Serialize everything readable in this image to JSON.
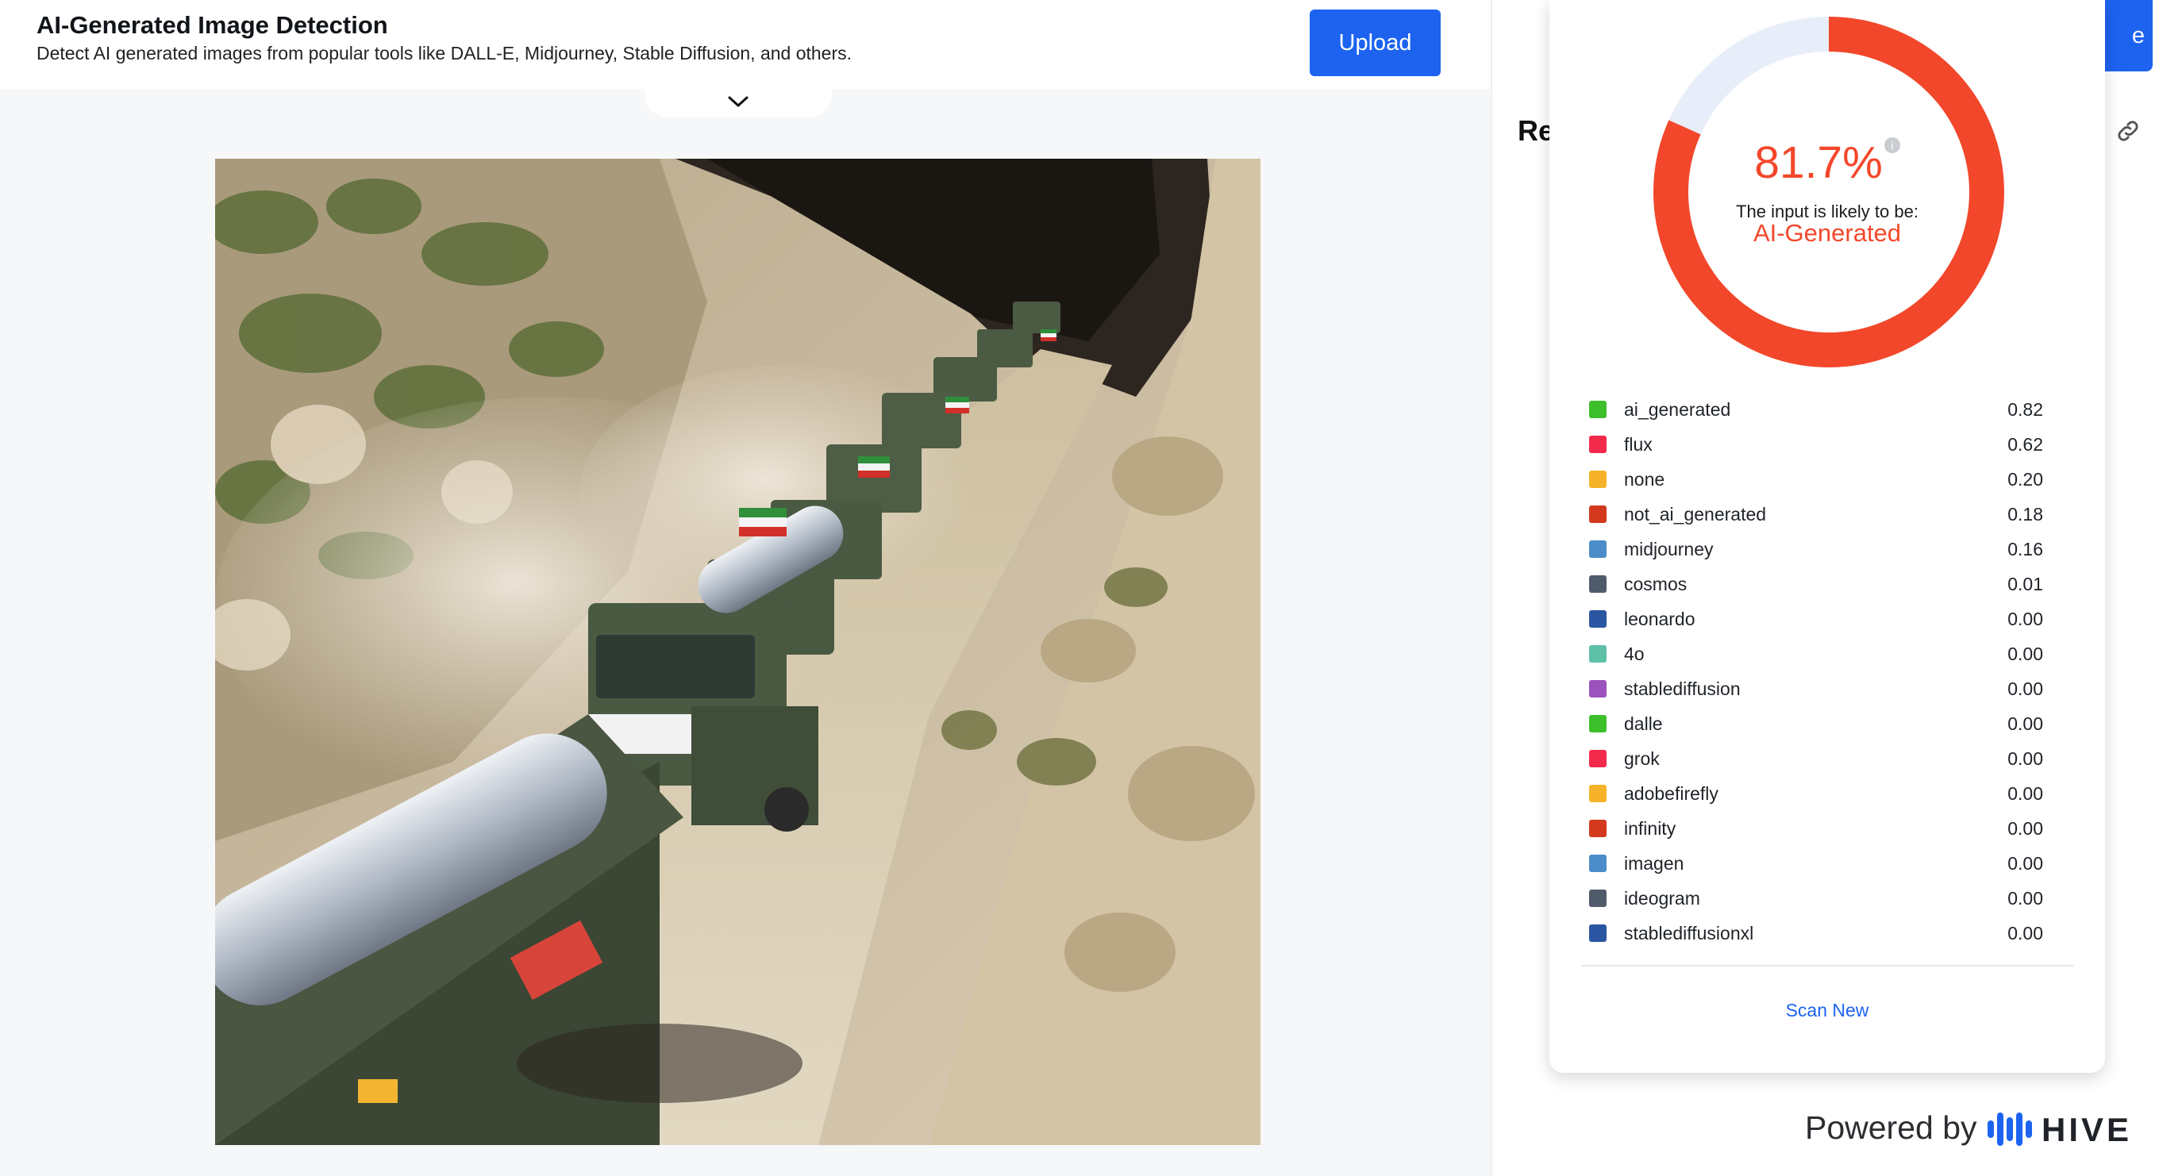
{
  "header": {
    "title": "AI-Generated Image Detection",
    "subtitle": "Detect AI generated images from popular tools like DALL-E, Midjourney, Stable Diffusion, and others.",
    "upload_label": "Upload",
    "collapse_icon": "chevron-down-icon"
  },
  "right_panel": {
    "heading_partial": "Re",
    "button_partial": "e",
    "link_icon": "link-icon"
  },
  "result": {
    "percentage": "81.7%",
    "percentage_value": 81.7,
    "info_icon": "i",
    "likely_label": "The input is likely to be:",
    "verdict": "AI-Generated",
    "accent_color": "#f3472b",
    "track_color": "#e8eef9"
  },
  "legend": [
    {
      "name": "ai_generated",
      "value": "0.82",
      "color": "#3cbf2a"
    },
    {
      "name": "flux",
      "value": "0.62",
      "color": "#f2294b"
    },
    {
      "name": "none",
      "value": "0.20",
      "color": "#f6b329"
    },
    {
      "name": "not_ai_generated",
      "value": "0.18",
      "color": "#d2391d"
    },
    {
      "name": "midjourney",
      "value": "0.16",
      "color": "#4c8cc8"
    },
    {
      "name": "cosmos",
      "value": "0.01",
      "color": "#505b6a"
    },
    {
      "name": "leonardo",
      "value": "0.00",
      "color": "#2a56a2"
    },
    {
      "name": "4o",
      "value": "0.00",
      "color": "#5fc0a8"
    },
    {
      "name": "stablediffusion",
      "value": "0.00",
      "color": "#9b52bd"
    },
    {
      "name": "dalle",
      "value": "0.00",
      "color": "#3cbf2a"
    },
    {
      "name": "grok",
      "value": "0.00",
      "color": "#f2294b"
    },
    {
      "name": "adobefirefly",
      "value": "0.00",
      "color": "#f6b329"
    },
    {
      "name": "infinity",
      "value": "0.00",
      "color": "#d2391d"
    },
    {
      "name": "imagen",
      "value": "0.00",
      "color": "#4c8cc8"
    },
    {
      "name": "ideogram",
      "value": "0.00",
      "color": "#505b6a"
    },
    {
      "name": "stablediffusionxl",
      "value": "0.00",
      "color": "#2a56a2"
    }
  ],
  "scan_new_label": "Scan New",
  "footer": {
    "powered_by": "Powered by",
    "brand": "HIVE",
    "brand_color": "#1d63f0"
  }
}
